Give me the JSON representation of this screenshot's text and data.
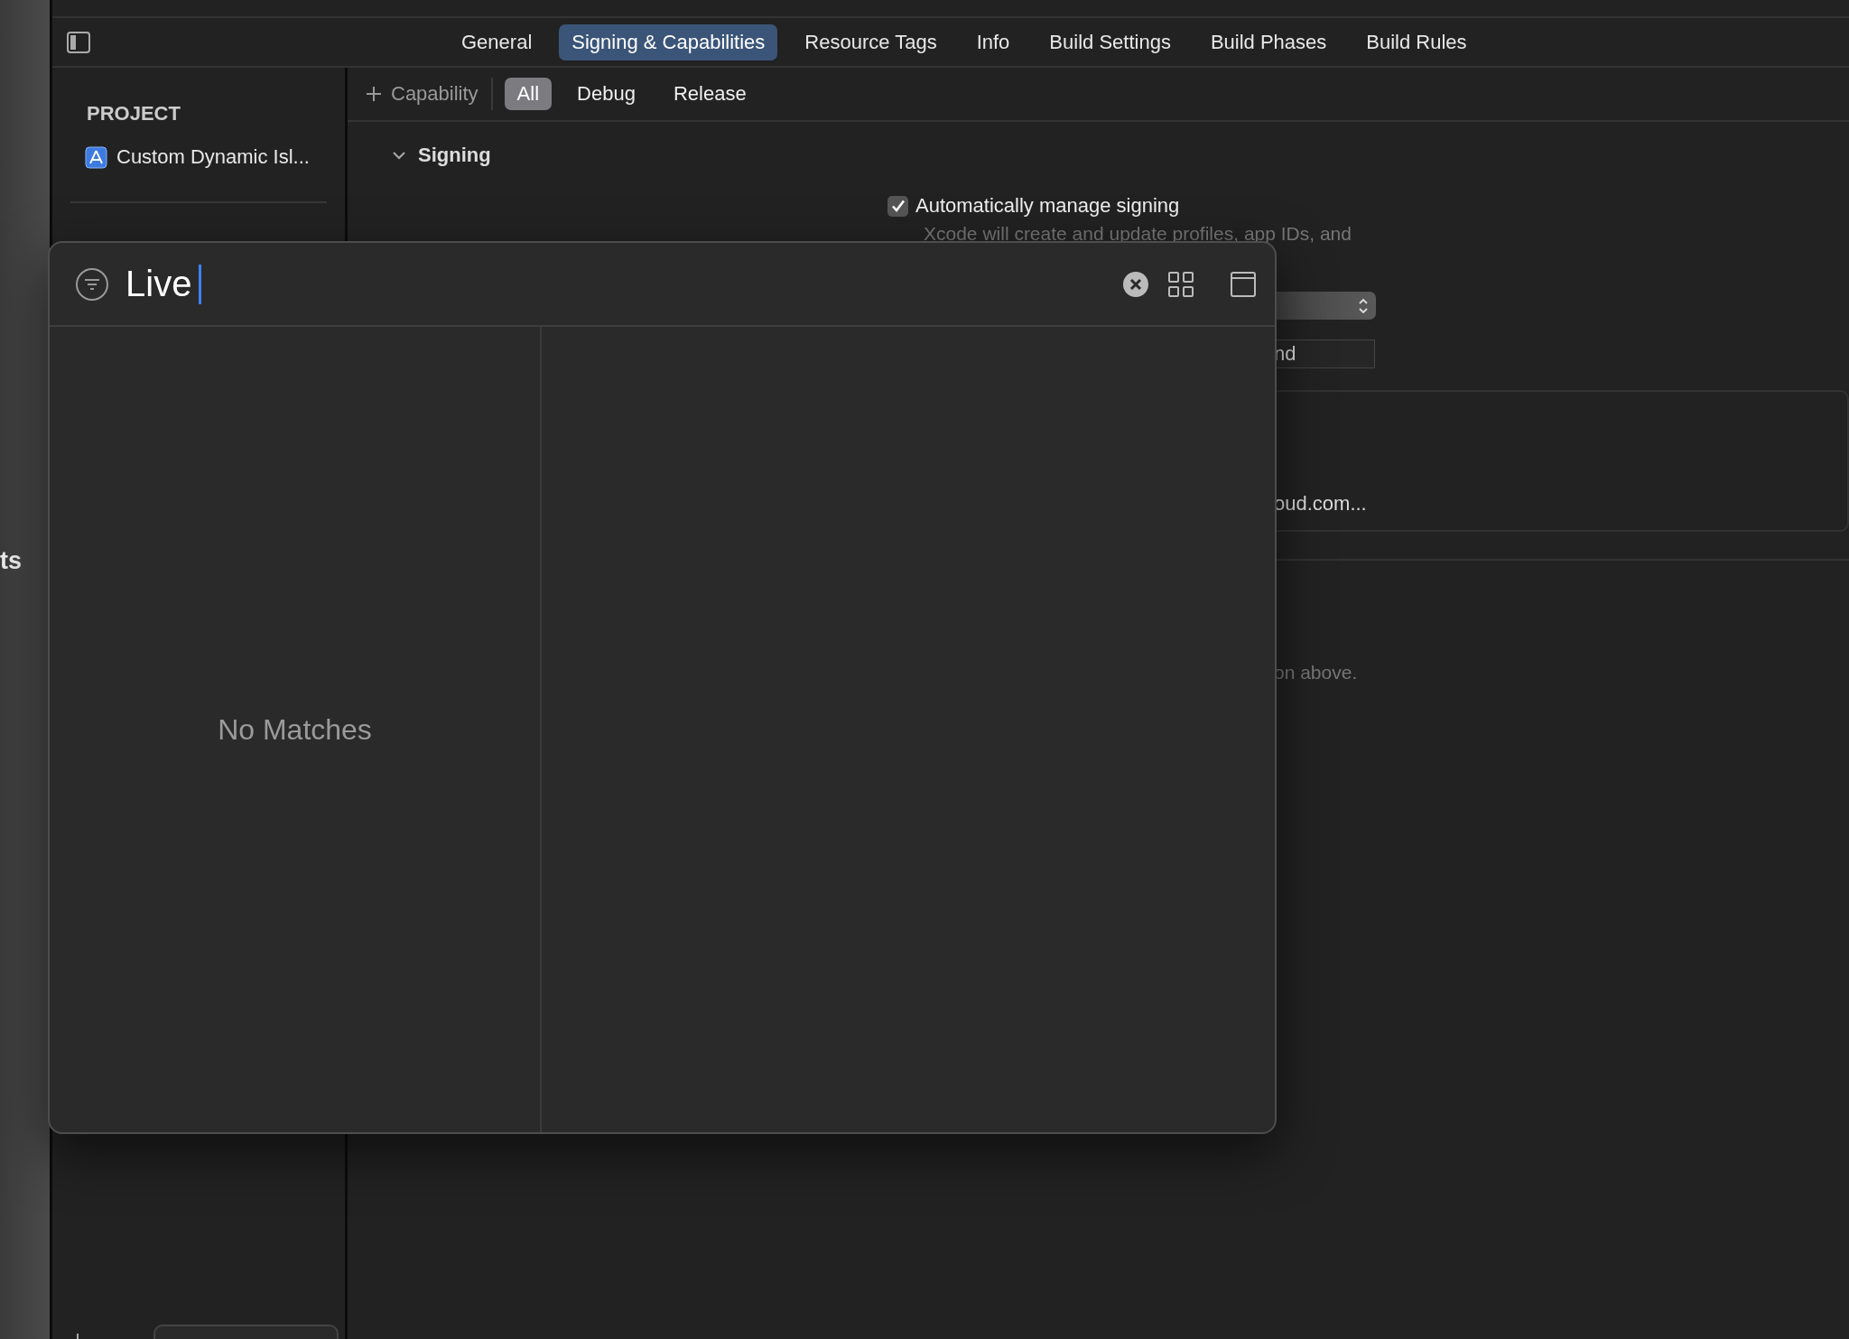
{
  "left_edge_text": "ts",
  "tabs": [
    {
      "label": "General",
      "selected": false
    },
    {
      "label": "Signing & Capabilities",
      "selected": true
    },
    {
      "label": "Resource Tags",
      "selected": false
    },
    {
      "label": "Info",
      "selected": false
    },
    {
      "label": "Build Settings",
      "selected": false
    },
    {
      "label": "Build Phases",
      "selected": false
    },
    {
      "label": "Build Rules",
      "selected": false
    }
  ],
  "sidebar": {
    "section": "PROJECT",
    "items": [
      {
        "label": "Custom Dynamic Isl..."
      }
    ]
  },
  "toolbar": {
    "add_label": "Capability",
    "configs": [
      {
        "label": "All",
        "selected": true
      },
      {
        "label": "Debug",
        "selected": false
      },
      {
        "label": "Release",
        "selected": false
      }
    ]
  },
  "signing": {
    "title": "Signing",
    "expanded": true,
    "auto_manage": {
      "label": "Automatically manage signing",
      "checked": true
    },
    "description": "Xcode will create and update profiles, app IDs, and",
    "fragments": [
      "nd",
      "oud.com...",
      "on above."
    ]
  },
  "overlay": {
    "query": "Live",
    "empty_text": "No Matches"
  }
}
